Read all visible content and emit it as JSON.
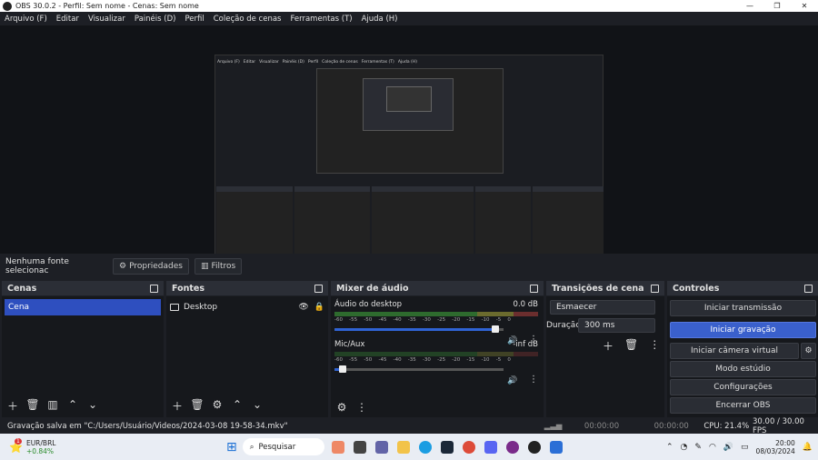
{
  "window": {
    "title": "OBS 30.0.2 - Perfil: Sem nome - Cenas: Sem nome"
  },
  "menu": [
    "Arquivo (F)",
    "Editar",
    "Visualizar",
    "Painéis (D)",
    "Perfil",
    "Coleção de cenas",
    "Ferramentas (T)",
    "Ajuda (H)"
  ],
  "source_bar": {
    "no_source": "Nenhuma fonte selecionac",
    "properties": "Propriedades",
    "filters": "Filtros"
  },
  "scenes": {
    "title": "Cenas",
    "items": [
      "Cena"
    ]
  },
  "sources": {
    "title": "Fontes",
    "items": [
      "Desktop"
    ]
  },
  "mixer": {
    "title": "Mixer de áudio",
    "channels": [
      {
        "name": "Áudio do desktop",
        "level": "0.0 dB",
        "fill": 0.95
      },
      {
        "name": "Mic/Aux",
        "level": "-inf dB",
        "fill": 0.05
      }
    ],
    "ticks": [
      "-60",
      "-55",
      "-50",
      "-45",
      "-40",
      "-35",
      "-30",
      "-25",
      "-20",
      "-15",
      "-10",
      "-5",
      "0"
    ]
  },
  "transitions": {
    "title": "Transições de cena",
    "type": "Esmaecer",
    "duration_label": "Duração",
    "duration": "300 ms"
  },
  "controls": {
    "title": "Controles",
    "buttons": [
      "Iniciar transmissão",
      "Iniciar gravação",
      "Iniciar câmera virtual",
      "Modo estúdio",
      "Configurações",
      "Encerrar OBS"
    ]
  },
  "status": {
    "message": "Gravação salva em \"C:/Users/Usuário/Videos/2024-03-08 19-58-34.mkv\"",
    "stream_time": "00:00:00",
    "rec_time": "00:00:00",
    "cpu": "CPU: 21.4%",
    "fps": "30.00 / 30.00 FPS"
  },
  "taskbar": {
    "ticker_name": "EUR/BRL",
    "ticker_change": "+0.84%",
    "badge": "1",
    "search": "Pesquisar",
    "time": "20:00",
    "date": "08/03/2024"
  },
  "preview_mini": {
    "menu": [
      "Arquivo (F)",
      "Editar",
      "Visualizar",
      "Painéis (D)",
      "Perfil",
      "Coleção de cenas",
      "Ferramentas (T)",
      "Ajuda (H)"
    ]
  }
}
